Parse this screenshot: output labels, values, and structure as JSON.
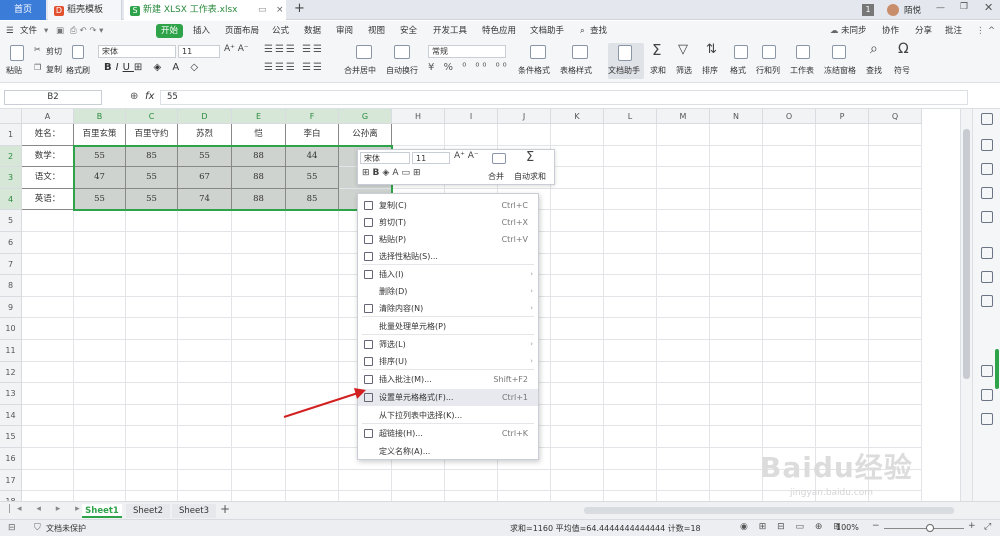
{
  "tabs": [
    {
      "label": "首页"
    },
    {
      "label": "稻壳模板"
    },
    {
      "label": "新建 XLSX 工作表.xlsx"
    }
  ],
  "title_user": "陌悦",
  "title_badge": "1",
  "menu": {
    "file": "文件",
    "items": [
      "开始",
      "插入",
      "页面布局",
      "公式",
      "数据",
      "审阅",
      "视图",
      "安全",
      "开发工具",
      "特色应用",
      "文档助手"
    ],
    "search": "查找",
    "sync": "未同步",
    "collab": "协作",
    "share": "分享",
    "comment": "批注"
  },
  "ribbon": {
    "paste": "粘贴",
    "cut": "剪切",
    "copy": "复制",
    "format_painter": "格式刷",
    "font": "宋体",
    "size": "11",
    "merge": "合并居中",
    "wrap": "自动换行",
    "number_format": "常规",
    "cond_format": "条件格式",
    "table_style": "表格样式",
    "doc_helper": "文档助手",
    "sum": "求和",
    "filter": "筛选",
    "sort": "排序",
    "format": "格式",
    "rowcol": "行和列",
    "sheet": "工作表",
    "freeze": "冻结窗格",
    "find": "查找",
    "symbol": "符号"
  },
  "formula_bar": {
    "name_box": "B2",
    "fx": "fx",
    "value": "55"
  },
  "columns": [
    "A",
    "B",
    "C",
    "D",
    "E",
    "F",
    "G",
    "H",
    "I",
    "J",
    "K",
    "L",
    "M",
    "N",
    "O",
    "P",
    "Q"
  ],
  "rows": [
    "1",
    "2",
    "3",
    "4",
    "5",
    "6",
    "7",
    "8",
    "9",
    "10",
    "11",
    "12",
    "13",
    "14",
    "15",
    "16",
    "17",
    "18"
  ],
  "table": [
    [
      "姓名：",
      "百里玄策",
      "百里守约",
      "苏烈",
      "恺",
      "李白",
      "公孙离"
    ],
    [
      "数学：",
      "55",
      "85",
      "55",
      "88",
      "44",
      ""
    ],
    [
      "语文：",
      "47",
      "55",
      "67",
      "88",
      "55",
      ""
    ],
    [
      "英语：",
      "55",
      "55",
      "74",
      "88",
      "85",
      ""
    ]
  ],
  "mini_toolbar": {
    "font": "宋体",
    "size": "11",
    "merge": "合并",
    "autosum": "自动求和"
  },
  "context_menu": [
    {
      "label": "复制(C)",
      "shortcut": "Ctrl+C"
    },
    {
      "label": "剪切(T)",
      "shortcut": "Ctrl+X"
    },
    {
      "label": "粘贴(P)",
      "shortcut": "Ctrl+V"
    },
    {
      "label": "选择性粘贴(S)...",
      "shortcut": ""
    },
    {
      "label": "插入(I)",
      "shortcut": ""
    },
    {
      "label": "删除(D)",
      "shortcut": ""
    },
    {
      "label": "清除内容(N)",
      "shortcut": ""
    },
    {
      "label": "批量处理单元格(P)",
      "shortcut": ""
    },
    {
      "label": "筛选(L)",
      "shortcut": ""
    },
    {
      "label": "排序(U)",
      "shortcut": ""
    },
    {
      "label": "插入批注(M)...",
      "shortcut": "Shift+F2"
    },
    {
      "label": "设置单元格格式(F)...",
      "shortcut": "Ctrl+1"
    },
    {
      "label": "从下拉列表中选择(K)...",
      "shortcut": ""
    },
    {
      "label": "超链接(H)...",
      "shortcut": "Ctrl+K"
    },
    {
      "label": "定义名称(A)...",
      "shortcut": ""
    }
  ],
  "sheets": [
    "Sheet1",
    "Sheet2",
    "Sheet3"
  ],
  "status": {
    "protect": "文档未保护",
    "stats": "求和=1160  平均值=64.4444444444444  计数=18",
    "zoom": "100%"
  },
  "watermark": {
    "brand": "Baidu经验",
    "url": "jingyan.baidu.com"
  },
  "colors": {
    "accent": "#2fa34a",
    "tab_home": "#3b7cd9",
    "arrow": "#d22020"
  }
}
